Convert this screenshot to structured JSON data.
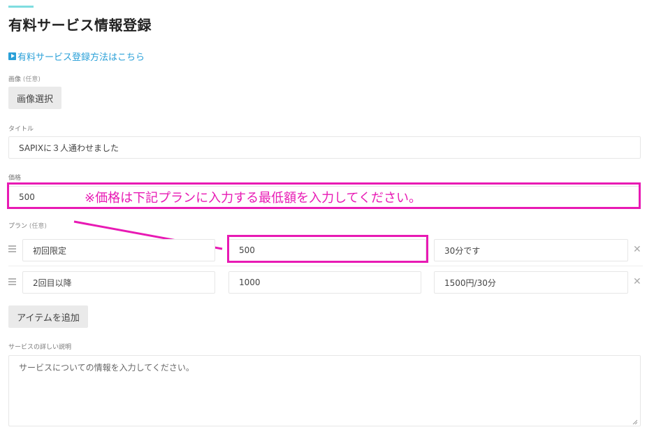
{
  "page": {
    "title": "有料サービス情報登録",
    "help_link": "有料サービス登録方法はこちら"
  },
  "image": {
    "label": "画像",
    "optional": "(任意)",
    "button": "画像選択"
  },
  "title_field": {
    "label": "タイトル",
    "value": "SAPIXに３人通わせました"
  },
  "price": {
    "label": "価格",
    "value": "500",
    "annotation": "※価格は下記プランに入力する最低額を入力してください。"
  },
  "plans": {
    "label": "プラン",
    "optional": "(任意)",
    "items": [
      {
        "name": "初回限定",
        "price": "500",
        "note": "30分です"
      },
      {
        "name": "2回目以降",
        "price": "1000",
        "note": "1500円/30分"
      }
    ],
    "add_button": "アイテムを追加"
  },
  "description": {
    "label": "サービスの詳しい説明",
    "placeholder": "サービスについての情報を入力してください。"
  },
  "colors": {
    "accent": "#7fdde0",
    "link": "#2aa0d8",
    "annotation_magenta": "#e81ab4"
  }
}
